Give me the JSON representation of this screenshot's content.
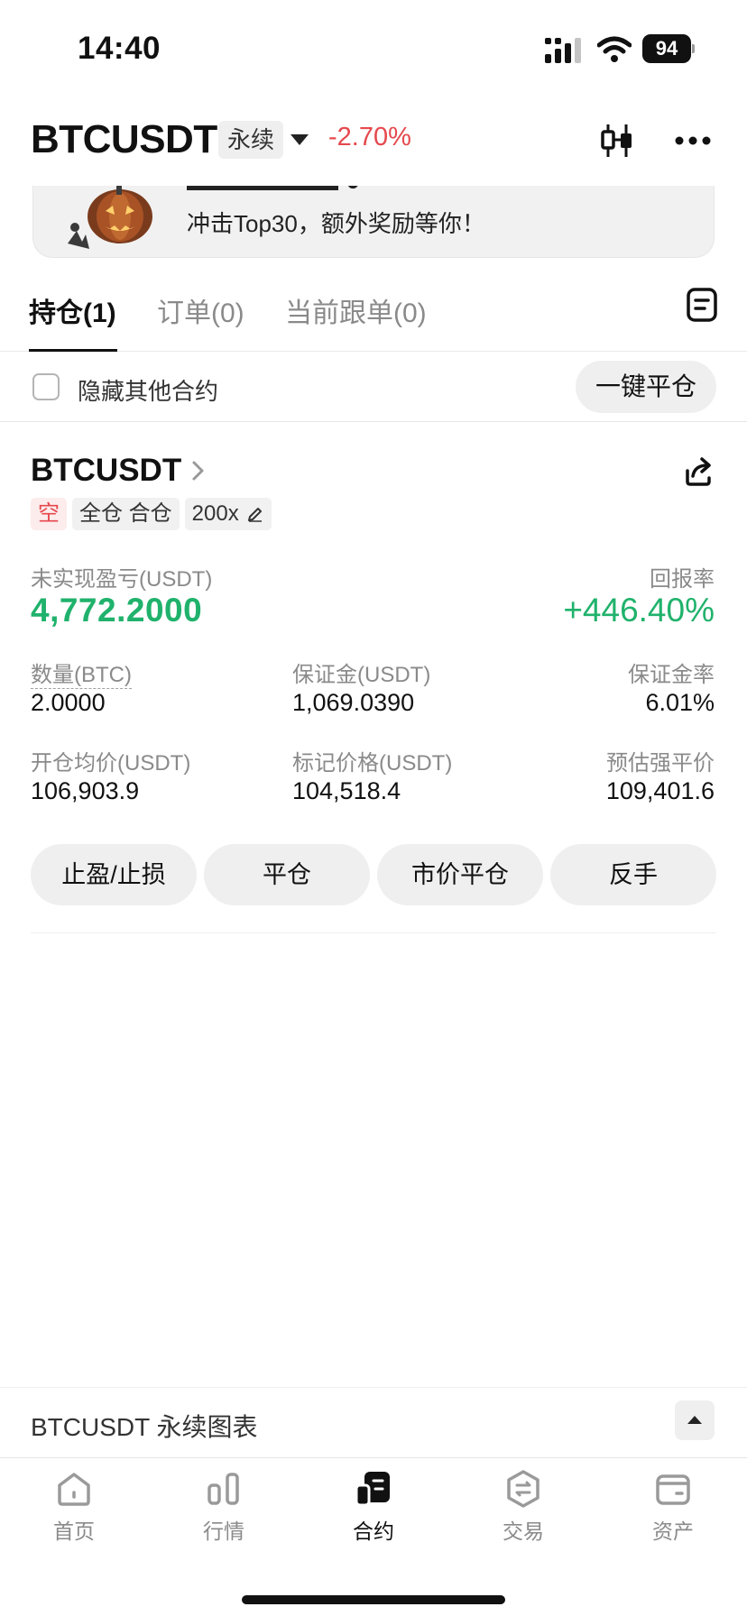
{
  "status_bar": {
    "time": "14:40",
    "battery": "94"
  },
  "header": {
    "symbol": "BTCUSDT",
    "contract_type": "永续",
    "change_pct": "-2.70%"
  },
  "banner": {
    "text": "冲击Top30，额外奖励等你！"
  },
  "tabs": [
    {
      "label": "持仓(1)"
    },
    {
      "label": "订单(0)"
    },
    {
      "label": "当前跟单(0)"
    }
  ],
  "filter": {
    "hide_label": "隐藏其他合约",
    "close_all_label": "一键平仓"
  },
  "position": {
    "symbol": "BTCUSDT",
    "side": "空",
    "margin_mode": "全仓 合仓",
    "leverage": "200x",
    "pnl_label": "未实现盈亏(USDT)",
    "pnl_value": "4,772.2000",
    "roe_label": "回报率",
    "roe_value": "+446.40%",
    "qty_label": "数量(BTC)",
    "qty_value": "2.0000",
    "margin_label": "保证金(USDT)",
    "margin_value": "1,069.0390",
    "margin_rate_label": "保证金率",
    "margin_rate_value": "6.01%",
    "entry_label": "开仓均价(USDT)",
    "entry_value": "106,903.9",
    "mark_label": "标记价格(USDT)",
    "mark_value": "104,518.4",
    "liq_label": "预估强平价",
    "liq_value": "109,401.6",
    "actions": [
      "止盈/止损",
      "平仓",
      "市价平仓",
      "反手"
    ]
  },
  "chart_bar": {
    "label": "BTCUSDT 永续图表"
  },
  "bottom_nav": [
    {
      "label": "首页",
      "icon": "home-icon"
    },
    {
      "label": "行情",
      "icon": "market-icon"
    },
    {
      "label": "合约",
      "icon": "futures-icon"
    },
    {
      "label": "交易",
      "icon": "trade-icon"
    },
    {
      "label": "资产",
      "icon": "wallet-icon"
    }
  ],
  "colors": {
    "up": "#20b26c",
    "down": "#e5484d"
  }
}
